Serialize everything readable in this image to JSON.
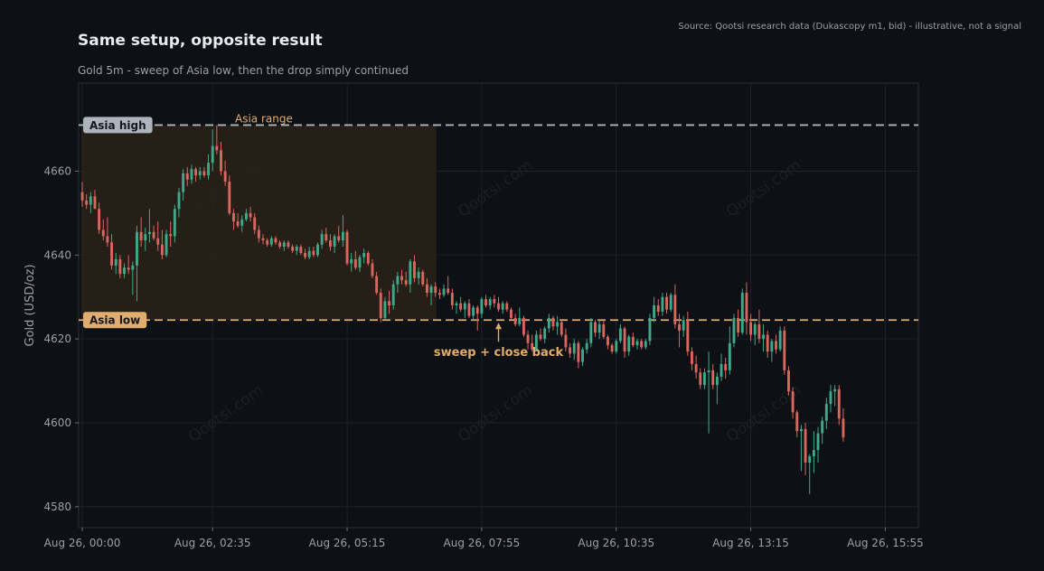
{
  "header": {
    "title": "Same setup, opposite result",
    "subtitle": "Gold 5m - sweep of Asia low, then the drop simply continued",
    "source": "Source: Qootsi research data (Dukascopy m1, bid) - illustrative, not a signal"
  },
  "watermark": "Qootsi.com",
  "colors": {
    "background": "#0d1015",
    "up": "#3fa98a",
    "down": "#d8675e",
    "asia_high_line": "#aeb4bc",
    "asia_low_line": "#e0ad6e",
    "asia_range_fill": "#2a2219",
    "annotation": "#e0ad6e"
  },
  "chart_data": {
    "type": "candlestick",
    "title": "Same setup, opposite result",
    "subtitle": "Gold 5m - sweep of Asia low, then the drop simply continued",
    "ylabel": "Gold (USD/oz)",
    "xlabel": "",
    "ylim": [
      4575,
      4681
    ],
    "yticks": [
      4580,
      4600,
      4620,
      4640,
      4660
    ],
    "x_tick_labels": [
      "Aug 26, 00:00",
      "Aug 26, 02:35",
      "Aug 26, 05:15",
      "Aug 26, 07:55",
      "Aug 26, 10:35",
      "Aug 26, 13:15",
      "Aug 26, 15:55"
    ],
    "x_tick_index": [
      0,
      31,
      63,
      95,
      127,
      159,
      191
    ],
    "bar_interval_minutes": 5,
    "grid": true,
    "levels": {
      "asia_high": {
        "label": "Asia high",
        "value": 4671
      },
      "asia_low": {
        "label": "Asia low",
        "value": 4624.5
      }
    },
    "asia_range": {
      "label": "Asia range",
      "start_index": 0,
      "end_index": 84,
      "low": 4624.5,
      "high": 4671
    },
    "annotation": {
      "text": "sweep + close back",
      "index": 99,
      "value": 4624.5
    },
    "ohlc": [
      [
        4655.0,
        4657.5,
        4651.5,
        4653.0
      ],
      [
        4653.0,
        4654.5,
        4651.0,
        4652.0
      ],
      [
        4652.0,
        4655.0,
        4650.0,
        4654.0
      ],
      [
        4654.0,
        4655.5,
        4651.0,
        4651.0
      ],
      [
        4651.0,
        4652.5,
        4645.0,
        4646.0
      ],
      [
        4646.0,
        4648.5,
        4643.5,
        4644.5
      ],
      [
        4644.5,
        4649.0,
        4642.0,
        4643.0
      ],
      [
        4643.0,
        4645.0,
        4636.5,
        4637.5
      ],
      [
        4637.5,
        4640.5,
        4635.5,
        4639.0
      ],
      [
        4639.0,
        4640.0,
        4634.5,
        4635.5
      ],
      [
        4635.5,
        4638.0,
        4634.5,
        4637.0
      ],
      [
        4637.0,
        4640.0,
        4635.5,
        4636.5
      ],
      [
        4636.5,
        4638.5,
        4630.5,
        4637.5
      ],
      [
        4637.5,
        4647.0,
        4629.0,
        4645.5
      ],
      [
        4645.5,
        4649.0,
        4642.0,
        4643.5
      ],
      [
        4643.5,
        4646.5,
        4641.0,
        4645.0
      ],
      [
        4645.0,
        4651.0,
        4643.0,
        4645.5
      ],
      [
        4645.5,
        4647.0,
        4643.5,
        4644.0
      ],
      [
        4644.0,
        4648.0,
        4641.0,
        4642.5
      ],
      [
        4642.5,
        4646.0,
        4639.0,
        4640.0
      ],
      [
        4640.0,
        4646.0,
        4639.5,
        4645.0
      ],
      [
        4645.0,
        4648.0,
        4642.0,
        4644.5
      ],
      [
        4644.5,
        4652.0,
        4643.0,
        4651.0
      ],
      [
        4651.0,
        4656.0,
        4649.0,
        4655.0
      ],
      [
        4655.0,
        4660.5,
        4653.0,
        4659.5
      ],
      [
        4659.5,
        4661.0,
        4656.5,
        4658.0
      ],
      [
        4658.0,
        4661.5,
        4657.0,
        4660.5
      ],
      [
        4660.5,
        4661.0,
        4657.5,
        4659.0
      ],
      [
        4659.0,
        4661.0,
        4658.0,
        4660.0
      ],
      [
        4660.0,
        4661.0,
        4658.5,
        4659.0
      ],
      [
        4659.0,
        4664.0,
        4658.0,
        4662.0
      ],
      [
        4662.0,
        4670.0,
        4660.0,
        4666.0
      ],
      [
        4666.0,
        4671.0,
        4664.0,
        4665.0
      ],
      [
        4665.0,
        4667.0,
        4659.0,
        4660.0
      ],
      [
        4660.0,
        4662.5,
        4656.5,
        4657.5
      ],
      [
        4657.5,
        4659.0,
        4649.5,
        4650.0
      ],
      [
        4650.0,
        4651.0,
        4646.0,
        4648.0
      ],
      [
        4648.0,
        4650.0,
        4646.5,
        4647.0
      ],
      [
        4647.0,
        4649.5,
        4645.5,
        4648.5
      ],
      [
        4648.5,
        4651.0,
        4648.0,
        4650.0
      ],
      [
        4650.0,
        4651.5,
        4648.0,
        4649.0
      ],
      [
        4649.0,
        4650.0,
        4645.0,
        4646.0
      ],
      [
        4646.0,
        4647.0,
        4643.0,
        4644.0
      ],
      [
        4644.0,
        4645.0,
        4642.5,
        4643.5
      ],
      [
        4643.5,
        4644.0,
        4642.0,
        4642.5
      ],
      [
        4642.5,
        4644.5,
        4642.0,
        4644.0
      ],
      [
        4644.0,
        4644.5,
        4642.5,
        4643.0
      ],
      [
        4643.0,
        4643.5,
        4641.5,
        4642.0
      ],
      [
        4642.0,
        4643.5,
        4641.0,
        4643.0
      ],
      [
        4643.0,
        4643.5,
        4641.5,
        4642.0
      ],
      [
        4642.0,
        4642.5,
        4640.5,
        4641.0
      ],
      [
        4641.0,
        4642.5,
        4640.0,
        4642.0
      ],
      [
        4642.0,
        4642.5,
        4640.0,
        4640.5
      ],
      [
        4640.5,
        4641.5,
        4639.0,
        4639.5
      ],
      [
        4639.5,
        4642.0,
        4639.0,
        4641.0
      ],
      [
        4641.0,
        4642.0,
        4639.5,
        4640.0
      ],
      [
        4640.0,
        4643.0,
        4639.5,
        4642.5
      ],
      [
        4642.5,
        4646.0,
        4641.5,
        4645.0
      ],
      [
        4645.0,
        4646.5,
        4643.0,
        4643.5
      ],
      [
        4643.5,
        4645.0,
        4641.0,
        4642.0
      ],
      [
        4642.0,
        4645.0,
        4640.5,
        4644.5
      ],
      [
        4644.5,
        4647.0,
        4643.0,
        4643.5
      ],
      [
        4643.5,
        4649.5,
        4642.0,
        4645.5
      ],
      [
        4645.5,
        4646.0,
        4637.5,
        4638.0
      ],
      [
        4638.0,
        4640.5,
        4636.0,
        4639.0
      ],
      [
        4639.0,
        4641.0,
        4636.5,
        4637.0
      ],
      [
        4637.0,
        4640.0,
        4636.0,
        4639.5
      ],
      [
        4639.5,
        4641.5,
        4638.0,
        4640.5
      ],
      [
        4640.5,
        4641.0,
        4637.5,
        4638.0
      ],
      [
        4638.0,
        4639.0,
        4634.5,
        4635.0
      ],
      [
        4635.0,
        4636.0,
        4630.5,
        4631.0
      ],
      [
        4631.0,
        4632.0,
        4624.0,
        4625.0
      ],
      [
        4625.0,
        4630.0,
        4624.5,
        4629.0
      ],
      [
        4629.0,
        4631.5,
        4626.0,
        4628.0
      ],
      [
        4628.0,
        4634.0,
        4627.0,
        4633.0
      ],
      [
        4633.0,
        4636.0,
        4631.0,
        4635.0
      ],
      [
        4635.0,
        4636.5,
        4633.0,
        4634.0
      ],
      [
        4634.0,
        4636.0,
        4632.5,
        4633.0
      ],
      [
        4633.0,
        4639.0,
        4631.0,
        4638.5
      ],
      [
        4638.5,
        4640.0,
        4633.5,
        4634.5
      ],
      [
        4634.5,
        4637.0,
        4633.0,
        4636.0
      ],
      [
        4636.0,
        4636.5,
        4632.5,
        4633.0
      ],
      [
        4633.0,
        4634.5,
        4630.0,
        4631.0
      ],
      [
        4631.0,
        4633.0,
        4628.0,
        4632.5
      ],
      [
        4632.5,
        4633.5,
        4630.0,
        4631.0
      ],
      [
        4631.0,
        4632.0,
        4629.5,
        4630.5
      ],
      [
        4630.5,
        4633.0,
        4630.0,
        4632.0
      ],
      [
        4632.0,
        4635.0,
        4630.5,
        4631.0
      ],
      [
        4631.0,
        4632.0,
        4627.0,
        4628.0
      ],
      [
        4628.0,
        4629.0,
        4626.0,
        4628.5
      ],
      [
        4628.5,
        4630.0,
        4626.5,
        4627.0
      ],
      [
        4627.0,
        4629.0,
        4625.0,
        4628.5
      ],
      [
        4628.5,
        4629.5,
        4625.0,
        4625.5
      ],
      [
        4625.5,
        4628.0,
        4624.5,
        4627.5
      ],
      [
        4627.5,
        4628.0,
        4622.0,
        4626.0
      ],
      [
        4626.0,
        4630.0,
        4625.0,
        4629.5
      ],
      [
        4629.5,
        4630.5,
        4627.5,
        4628.0
      ],
      [
        4628.0,
        4630.0,
        4627.0,
        4629.5
      ],
      [
        4629.5,
        4630.5,
        4627.5,
        4628.5
      ],
      [
        4628.5,
        4630.0,
        4626.5,
        4627.0
      ],
      [
        4627.0,
        4629.0,
        4626.0,
        4628.5
      ],
      [
        4628.5,
        4629.0,
        4626.5,
        4627.0
      ],
      [
        4627.0,
        4627.5,
        4624.5,
        4625.0
      ],
      [
        4625.0,
        4626.0,
        4623.0,
        4623.5
      ],
      [
        4623.5,
        4627.5,
        4623.0,
        4625.0
      ],
      [
        4625.0,
        4625.5,
        4620.5,
        4621.0
      ],
      [
        4621.0,
        4622.0,
        4617.5,
        4619.0
      ],
      [
        4619.0,
        4621.0,
        4617.0,
        4617.5
      ],
      [
        4617.5,
        4622.0,
        4617.0,
        4621.0
      ],
      [
        4621.0,
        4622.5,
        4619.5,
        4620.0
      ],
      [
        4620.0,
        4623.0,
        4619.0,
        4622.5
      ],
      [
        4622.5,
        4626.0,
        4621.5,
        4625.0
      ],
      [
        4625.0,
        4625.5,
        4622.0,
        4623.0
      ],
      [
        4623.0,
        4625.5,
        4621.0,
        4624.0
      ],
      [
        4624.0,
        4624.5,
        4620.5,
        4621.0
      ],
      [
        4621.0,
        4622.5,
        4617.0,
        4618.0
      ],
      [
        4618.0,
        4619.0,
        4615.5,
        4616.5
      ],
      [
        4616.5,
        4620.0,
        4615.0,
        4619.0
      ],
      [
        4619.0,
        4619.5,
        4613.0,
        4614.5
      ],
      [
        4614.5,
        4618.0,
        4613.5,
        4617.5
      ],
      [
        4617.5,
        4620.0,
        4616.5,
        4619.0
      ],
      [
        4619.0,
        4625.0,
        4618.0,
        4624.0
      ],
      [
        4624.0,
        4624.5,
        4620.5,
        4621.5
      ],
      [
        4621.5,
        4624.5,
        4620.0,
        4623.5
      ],
      [
        4623.5,
        4624.5,
        4620.0,
        4620.5
      ],
      [
        4620.5,
        4621.0,
        4617.5,
        4618.5
      ],
      [
        4618.5,
        4619.0,
        4616.5,
        4617.0
      ],
      [
        4617.0,
        4620.0,
        4616.5,
        4619.5
      ],
      [
        4619.5,
        4623.5,
        4619.0,
        4622.5
      ],
      [
        4622.5,
        4623.0,
        4615.5,
        4617.0
      ],
      [
        4617.0,
        4621.0,
        4616.0,
        4620.5
      ],
      [
        4620.5,
        4621.5,
        4618.0,
        4618.5
      ],
      [
        4618.5,
        4620.0,
        4617.5,
        4619.5
      ],
      [
        4619.5,
        4620.0,
        4617.5,
        4618.0
      ],
      [
        4618.0,
        4620.0,
        4617.5,
        4619.5
      ],
      [
        4619.5,
        4626.0,
        4618.5,
        4625.0
      ],
      [
        4625.0,
        4630.0,
        4624.0,
        4628.0
      ],
      [
        4628.0,
        4629.5,
        4625.5,
        4626.5
      ],
      [
        4626.5,
        4631.0,
        4625.5,
        4630.0
      ],
      [
        4630.0,
        4631.0,
        4626.0,
        4627.0
      ],
      [
        4627.0,
        4631.0,
        4626.5,
        4630.5
      ],
      [
        4630.5,
        4633.0,
        4622.5,
        4623.5
      ],
      [
        4623.5,
        4626.0,
        4618.0,
        4622.0
      ],
      [
        4622.0,
        4625.5,
        4620.5,
        4624.5
      ],
      [
        4624.5,
        4626.5,
        4616.0,
        4617.0
      ],
      [
        4617.0,
        4618.0,
        4612.5,
        4614.0
      ],
      [
        4614.0,
        4616.0,
        4610.5,
        4612.0
      ],
      [
        4612.0,
        4613.0,
        4608.0,
        4609.0
      ],
      [
        4609.0,
        4613.0,
        4608.0,
        4612.0
      ],
      [
        4612.0,
        4617.0,
        4597.5,
        4612.5
      ],
      [
        4612.5,
        4614.0,
        4608.0,
        4609.0
      ],
      [
        4609.0,
        4612.0,
        4604.5,
        4611.0
      ],
      [
        4611.0,
        4616.5,
        4610.0,
        4614.0
      ],
      [
        4614.0,
        4615.5,
        4610.5,
        4612.5
      ],
      [
        4612.5,
        4623.0,
        4611.5,
        4619.0
      ],
      [
        4619.0,
        4626.0,
        4618.0,
        4625.0
      ],
      [
        4625.0,
        4627.0,
        4620.5,
        4621.5
      ],
      [
        4621.5,
        4632.0,
        4621.0,
        4631.0
      ],
      [
        4631.0,
        4633.5,
        4621.0,
        4624.0
      ],
      [
        4624.0,
        4626.0,
        4619.5,
        4621.0
      ],
      [
        4621.0,
        4624.0,
        4618.5,
        4623.5
      ],
      [
        4623.5,
        4627.0,
        4619.0,
        4620.0
      ],
      [
        4620.0,
        4623.5,
        4617.0,
        4621.0
      ],
      [
        4621.0,
        4622.0,
        4615.5,
        4617.0
      ],
      [
        4617.0,
        4620.0,
        4614.5,
        4619.5
      ],
      [
        4619.5,
        4621.0,
        4616.5,
        4617.5
      ],
      [
        4617.5,
        4623.0,
        4617.0,
        4622.0
      ],
      [
        4622.0,
        4623.0,
        4611.5,
        4612.5
      ],
      [
        4612.5,
        4613.5,
        4606.5,
        4607.5
      ],
      [
        4607.5,
        4608.5,
        4601.0,
        4602.5
      ],
      [
        4602.5,
        4603.0,
        4596.5,
        4598.0
      ],
      [
        4598.0,
        4599.5,
        4588.5,
        4598.5
      ],
      [
        4598.5,
        4600.0,
        4587.5,
        4590.5
      ],
      [
        4590.5,
        4592.5,
        4583.0,
        4592.0
      ],
      [
        4592.0,
        4598.0,
        4588.0,
        4593.5
      ],
      [
        4593.5,
        4599.0,
        4590.5,
        4597.5
      ],
      [
        4597.5,
        4601.5,
        4595.0,
        4600.5
      ],
      [
        4600.5,
        4606.0,
        4598.5,
        4604.5
      ],
      [
        4604.5,
        4609.0,
        4602.5,
        4607.5
      ],
      [
        4607.5,
        4609.0,
        4604.0,
        4608.0
      ],
      [
        4608.0,
        4609.0,
        4599.5,
        4601.0
      ],
      [
        4601.0,
        4603.5,
        4595.5,
        4596.5
      ]
    ]
  }
}
